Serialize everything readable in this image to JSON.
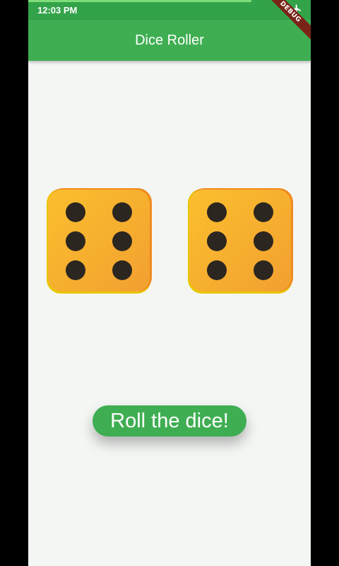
{
  "status_bar": {
    "time": "12:03 PM",
    "airplane_icon": "airplane-icon",
    "progress": 0.79
  },
  "debug_banner": "DEBUG",
  "app_bar": {
    "title": "Dice Roller",
    "color": "#3fae52"
  },
  "dice": [
    {
      "value": 6,
      "color": "#f7b228"
    },
    {
      "value": 6,
      "color": "#f7b228"
    }
  ],
  "roll_button": {
    "label": "Roll the dice!",
    "color": "#3fae52"
  }
}
